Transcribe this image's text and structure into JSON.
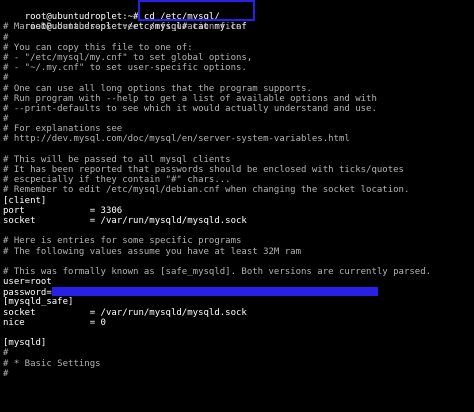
{
  "terminal": {
    "prompt1": "root@ubuntudroplet:~# ",
    "cmd1": "cd /etc/mysql/",
    "prompt2": "root@ubuntudroplet:",
    "cmd2": "/etc/mysql# cat my.cnf",
    "lines": [
      {
        "t": "# MariaDB database server configuration file.",
        "c": "comment"
      },
      {
        "t": "#",
        "c": "comment"
      },
      {
        "t": "# You can copy this file to one of:",
        "c": "comment"
      },
      {
        "t": "# - \"/etc/mysql/my.cnf\" to set global options,",
        "c": "comment"
      },
      {
        "t": "# - \"~/.my.cnf\" to set user-specific options.",
        "c": "comment"
      },
      {
        "t": "#",
        "c": "comment"
      },
      {
        "t": "# One can use all long options that the program supports.",
        "c": "comment"
      },
      {
        "t": "# Run program with --help to get a list of available options and with",
        "c": "comment"
      },
      {
        "t": "# --print-defaults to see which it would actually understand and use.",
        "c": "comment"
      },
      {
        "t": "#",
        "c": "comment"
      },
      {
        "t": "# For explanations see",
        "c": "comment"
      },
      {
        "t": "# http://dev.mysql.com/doc/mysql/en/server-system-variables.html",
        "c": "comment"
      },
      {
        "t": "",
        "c": "white"
      },
      {
        "t": "# This will be passed to all mysql clients",
        "c": "comment"
      },
      {
        "t": "# It has been reported that passwords should be enclosed with ticks/quotes",
        "c": "comment"
      },
      {
        "t": "# escpecially if they contain \"#\" chars...",
        "c": "comment"
      },
      {
        "t": "# Remember to edit /etc/mysql/debian.cnf when changing the socket location.",
        "c": "comment"
      },
      {
        "t": "[client]",
        "c": "white"
      },
      {
        "t": "port            = 3306",
        "c": "white"
      },
      {
        "t": "socket          = /var/run/mysqld/mysqld.sock",
        "c": "white"
      },
      {
        "t": "",
        "c": "white"
      },
      {
        "t": "# Here is entries for some specific programs",
        "c": "comment"
      },
      {
        "t": "# The following values assume you have at least 32M ram",
        "c": "comment"
      },
      {
        "t": "",
        "c": "white"
      },
      {
        "t": "# This was formally known as [safe_mysqld]. Both versions are currently parsed.",
        "c": "comment"
      },
      {
        "t": "user=root",
        "c": "white"
      },
      {
        "t": "password=",
        "c": "white",
        "redacted": true
      },
      {
        "t": "[mysqld_safe]",
        "c": "white"
      },
      {
        "t": "socket          = /var/run/mysqld/mysqld.sock",
        "c": "white"
      },
      {
        "t": "nice            = 0",
        "c": "white"
      },
      {
        "t": "",
        "c": "white"
      },
      {
        "t": "[mysqld]",
        "c": "white"
      },
      {
        "t": "#",
        "c": "comment"
      },
      {
        "t": "# * Basic Settings",
        "c": "comment"
      },
      {
        "t": "#",
        "c": "comment"
      },
      {
        "t": "",
        "c": "white"
      }
    ]
  },
  "colors": {
    "background": "#000000",
    "comment": "#b3b3b3",
    "text": "#ffffff",
    "highlight": "#2a1fe6"
  }
}
